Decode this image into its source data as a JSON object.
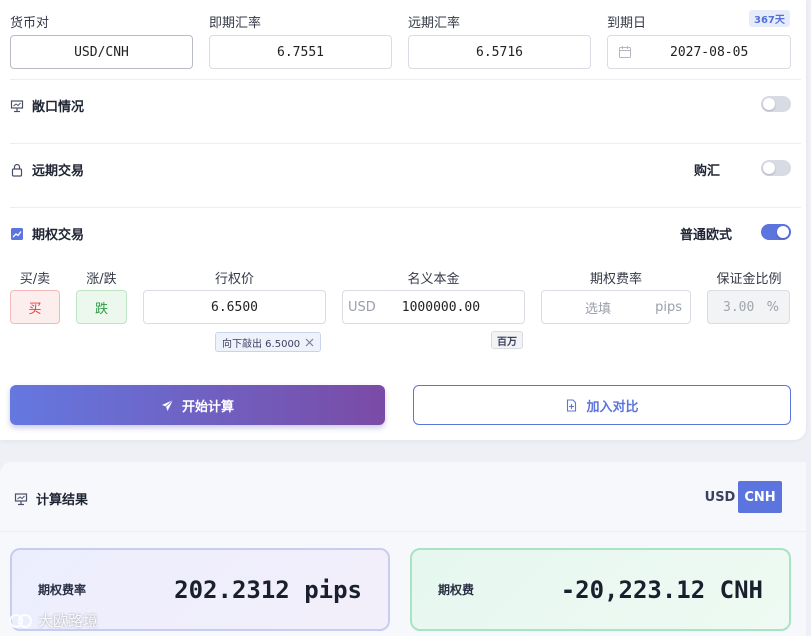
{
  "form": {
    "pair_label": "货币对",
    "pair_value": "USD/CNH",
    "spot_label": "即期汇率",
    "spot_value": "6.7551",
    "forward_label": "远期汇率",
    "forward_value": "6.5716",
    "expiry_label": "到期日",
    "expiry_value": "2027-08-05",
    "days_badge": "367天"
  },
  "sections": {
    "exposure": {
      "title": "敞口情况",
      "toggle_on": false
    },
    "forward": {
      "title": "远期交易",
      "side_label": "购汇",
      "toggle_on": false
    },
    "option": {
      "title": "期权交易",
      "style_label": "普通欧式",
      "toggle_on": true
    }
  },
  "option_table": {
    "headers": [
      "买/卖",
      "涨/跌",
      "行权价",
      "名义本金",
      "期权费率",
      "保证金比例"
    ],
    "buy_sell": "买",
    "up_down": "跌",
    "strike": "6.6500",
    "strike_tag": "向下敲出 6.5000",
    "notional_ccy": "USD",
    "notional": "1000000.00",
    "notional_unit_tag": "百万",
    "premium_rate_placeholder": "选填",
    "premium_rate_unit": "pips",
    "margin_ratio": "3.00",
    "margin_unit": "%"
  },
  "actions": {
    "calculate": "开始计算",
    "compare": "加入对比"
  },
  "results": {
    "title": "计算结果",
    "ccy_options": [
      "USD",
      "CNH"
    ],
    "ccy_selected": "CNH",
    "rate_label": "期权费率",
    "rate_value": "202.2312 pips",
    "fee_label": "期权费",
    "fee_value": "-20,223.12 CNH"
  },
  "watermark": "大欧路境",
  "colors": {
    "accent": "#5b74de",
    "buy_red": "#e23a3a",
    "down_green": "#2e9a45"
  }
}
